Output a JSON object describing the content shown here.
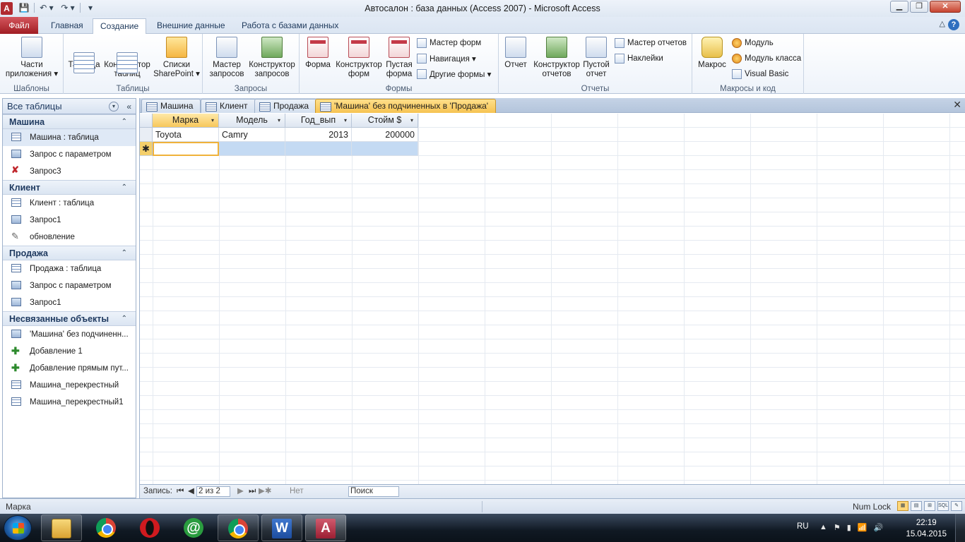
{
  "window": {
    "title": "Автосалон : база данных (Access 2007)  -  Microsoft Access",
    "app_icon_letter": "A",
    "controls": {
      "minimize": "▁",
      "maximize": "❐",
      "close": "✕"
    }
  },
  "quick_access": {
    "save": "💾",
    "undo": "↶ ▾",
    "redo": "↷ ▾",
    "customize": "▾"
  },
  "ribbon_tabs": [
    {
      "label": "Файл"
    },
    {
      "label": "Главная"
    },
    {
      "label": "Создание"
    },
    {
      "label": "Внешние данные"
    },
    {
      "label": "Работа с базами данных"
    }
  ],
  "ribbon_minimize": "△",
  "help": "?",
  "ribbon": {
    "templates": {
      "label": "Шаблоны",
      "app_parts_line1": "Части",
      "app_parts_line2": "приложения ▾"
    },
    "tables": {
      "label": "Таблицы",
      "table": "Таблица",
      "table_designer_line1": "Конструктор",
      "table_designer_line2": "таблиц",
      "sharepoint_line1": "Списки",
      "sharepoint_line2": "SharePoint ▾"
    },
    "queries": {
      "label": "Запросы",
      "wizard_line1": "Мастер",
      "wizard_line2": "запросов",
      "designer_line1": "Конструктор",
      "designer_line2": "запросов"
    },
    "forms": {
      "label": "Формы",
      "form": "Форма",
      "designer_line1": "Конструктор",
      "designer_line2": "форм",
      "blank_line1": "Пустая",
      "blank_line2": "форма",
      "wizard": "Мастер форм",
      "navigation": "Навигация ▾",
      "other": "Другие формы ▾"
    },
    "reports": {
      "label": "Отчеты",
      "report": "Отчет",
      "designer_line1": "Конструктор",
      "designer_line2": "отчетов",
      "blank_line1": "Пустой",
      "blank_line2": "отчет",
      "wizard": "Мастер отчетов",
      "labels": "Наклейки"
    },
    "macros": {
      "label": "Макросы и код",
      "macro": "Макрос",
      "module": "Модуль",
      "class_module": "Модуль класса",
      "vba": "Visual Basic"
    }
  },
  "nav": {
    "header": "Все таблицы",
    "dropdown": "▾",
    "collapse": "«",
    "sections": [
      {
        "title": "Машина",
        "chevron": "⌃",
        "items": [
          {
            "label": "Машина : таблица"
          },
          {
            "label": "Запрос с параметром"
          },
          {
            "label": "Запрос3"
          }
        ]
      },
      {
        "title": "Клиент",
        "chevron": "⌃",
        "items": [
          {
            "label": "Клиент : таблица"
          },
          {
            "label": "Запрос1"
          },
          {
            "label": "обновление"
          }
        ]
      },
      {
        "title": "Продажа",
        "chevron": "⌃",
        "items": [
          {
            "label": "Продажа : таблица"
          },
          {
            "label": "Запрос с параметром"
          },
          {
            "label": "Запрос1"
          }
        ]
      },
      {
        "title": "Несвязанные объекты",
        "chevron": "⌃",
        "items": [
          {
            "label": "'Машина' без подчиненн..."
          },
          {
            "label": "Добавление 1"
          },
          {
            "label": "Добавление прямым пут..."
          },
          {
            "label": "Машина_перекрестный"
          },
          {
            "label": "Машина_перекрестный1"
          }
        ]
      }
    ]
  },
  "doc_tabs": [
    {
      "label": "Машина"
    },
    {
      "label": "Клиент"
    },
    {
      "label": "Продажа"
    },
    {
      "label": "'Машина' без подчиненных в 'Продажа'"
    }
  ],
  "doc_close": "✕",
  "datasheet": {
    "columns": [
      {
        "label": "Марка",
        "arrow": "▾"
      },
      {
        "label": "Модель",
        "arrow": "▾"
      },
      {
        "label": "Год_вып",
        "arrow": "▾"
      },
      {
        "label": "Стойм $",
        "arrow": "▾"
      }
    ],
    "rows": [
      [
        "Toyota",
        "Camry",
        "2013",
        "200000"
      ]
    ],
    "new_row_marker": "✱"
  },
  "record_bar": {
    "label": "Запись:",
    "first": "⏮",
    "prev": "◀",
    "position": "2 из 2",
    "next": "▶",
    "last": "⏭",
    "new": "▶✱",
    "filter": "Нет фильтра",
    "search": "Поиск"
  },
  "statusbar": {
    "field": "Марка",
    "numlock": "Num Lock",
    "views": [
      "▦",
      "▤",
      "⊞",
      "SQL",
      "✎"
    ]
  },
  "taskbar": {
    "lang": "RU",
    "tray_icons": [
      "▲",
      "⚑",
      "▮",
      "📶",
      "🔊"
    ],
    "time": "22:19",
    "date": "15.04.2015"
  }
}
